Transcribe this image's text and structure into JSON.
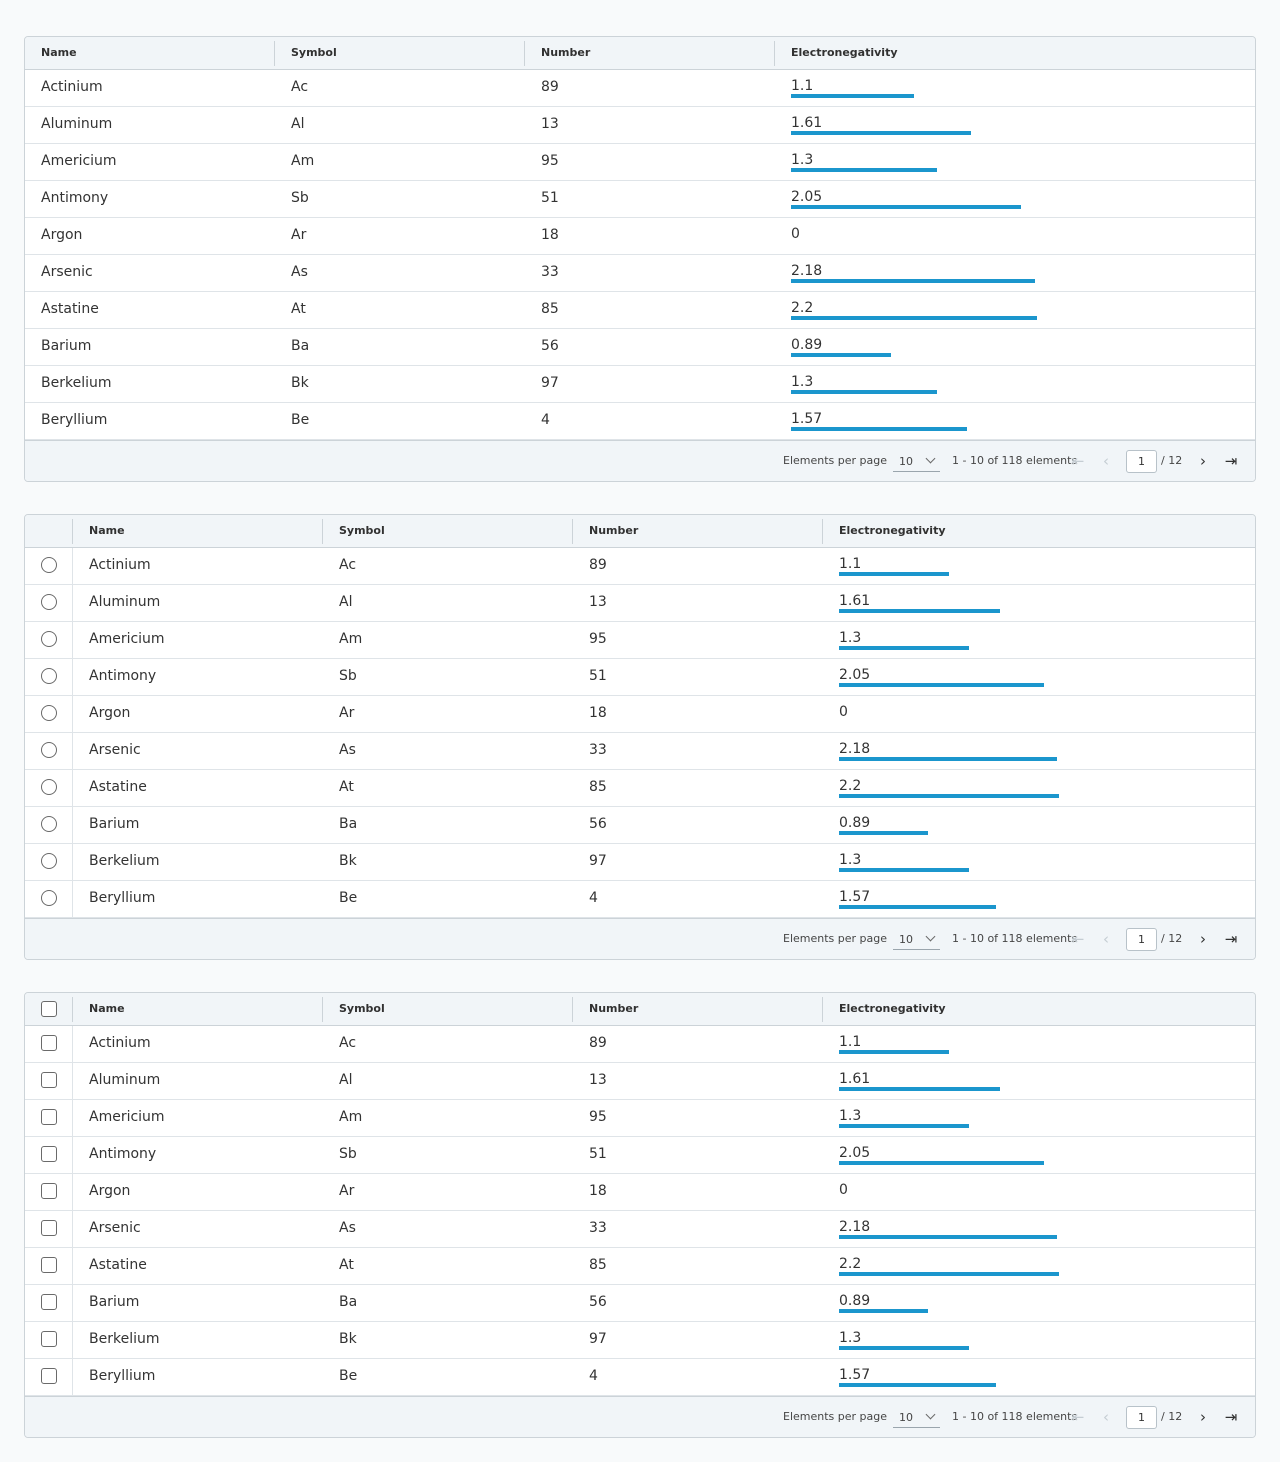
{
  "columns": {
    "name": "Name",
    "symbol": "Symbol",
    "number": "Number",
    "electronegativity": "Electronegativity"
  },
  "elements": [
    {
      "name": "Actinium",
      "symbol": "Ac",
      "number": "89",
      "electronegativity": "1.1"
    },
    {
      "name": "Aluminum",
      "symbol": "Al",
      "number": "13",
      "electronegativity": "1.61"
    },
    {
      "name": "Americium",
      "symbol": "Am",
      "number": "95",
      "electronegativity": "1.3"
    },
    {
      "name": "Antimony",
      "symbol": "Sb",
      "number": "51",
      "electronegativity": "2.05"
    },
    {
      "name": "Argon",
      "symbol": "Ar",
      "number": "18",
      "electronegativity": "0"
    },
    {
      "name": "Arsenic",
      "symbol": "As",
      "number": "33",
      "electronegativity": "2.18"
    },
    {
      "name": "Astatine",
      "symbol": "At",
      "number": "85",
      "electronegativity": "2.2"
    },
    {
      "name": "Barium",
      "symbol": "Ba",
      "number": "56",
      "electronegativity": "0.89"
    },
    {
      "name": "Berkelium",
      "symbol": "Bk",
      "number": "97",
      "electronegativity": "1.3"
    },
    {
      "name": "Beryllium",
      "symbol": "Be",
      "number": "4",
      "electronegativity": "1.57"
    }
  ],
  "pagination": {
    "per_page_label": "Elements per page",
    "per_page_value": "10",
    "range_text": "1 - 10 of 118 elements",
    "current_page": "1",
    "total_pages_text": "/ 12"
  },
  "grids": [
    {
      "selection": "none"
    },
    {
      "selection": "single"
    },
    {
      "selection": "multi"
    }
  ],
  "colors": {
    "bar": "#1b96cd",
    "header_bg": "#f1f5f8",
    "border": "#ccd3d8"
  },
  "icons": {
    "first": "first-page-icon",
    "prev": "previous-page-icon",
    "next": "next-page-icon",
    "last": "last-page-icon",
    "dropdown": "chevron-down-icon"
  }
}
